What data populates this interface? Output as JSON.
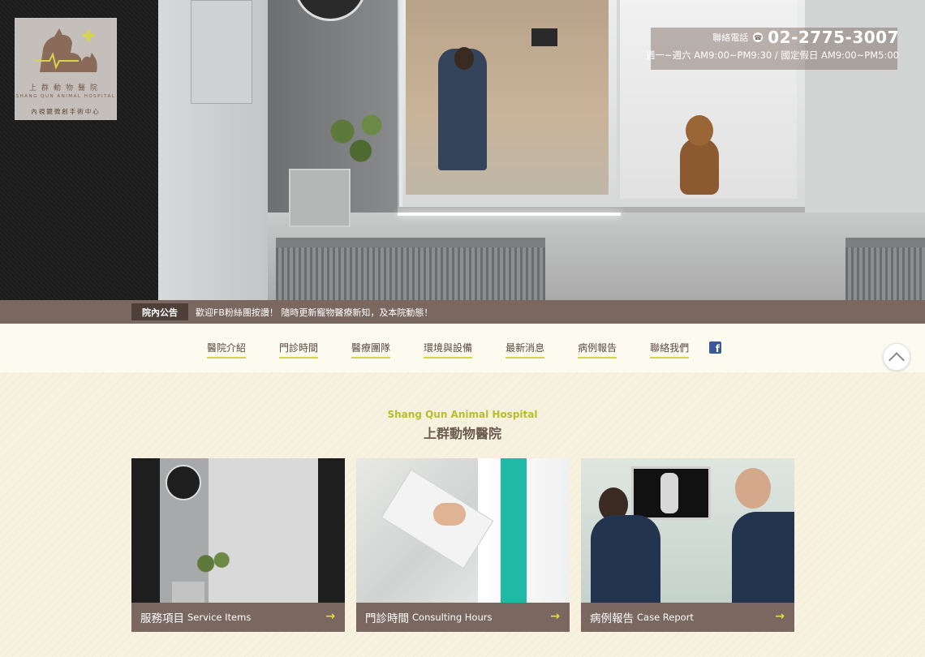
{
  "logo": {
    "name_zh": "上群動物醫院",
    "name_en": "SHANG QUN ANIMAL HOSPITAL",
    "tagline": "內視鏡微創手術中心"
  },
  "contact": {
    "phone_label": "聯絡電話",
    "phone_icon": "phone-icon",
    "phone": "02-2775-3007",
    "hours": "週一~週六 AM9:00~PM9:30 / 國定假日 AM9:00~PM5:00"
  },
  "notice": {
    "badge": "院內公告",
    "text": "歡迎FB粉絲團按讚！ 隨時更新寵物醫療新知，及本院動態！"
  },
  "nav": {
    "items": [
      {
        "label": "醫院介紹"
      },
      {
        "label": "門診時間"
      },
      {
        "label": "醫療團隊"
      },
      {
        "label": "環境與設備"
      },
      {
        "label": "最新消息"
      },
      {
        "label": "病例報告"
      },
      {
        "label": "聯絡我們"
      }
    ],
    "facebook_icon": "facebook-icon",
    "facebook_glyph": "f",
    "back_to_top_icon": "chevron-up-icon"
  },
  "section": {
    "subtitle_en": "Shang Qun Animal Hospital",
    "title_zh": "上群動物醫院"
  },
  "cards": [
    {
      "title_zh": "服務項目",
      "title_en": "Service Items",
      "arrow": "→"
    },
    {
      "title_zh": "門診時間",
      "title_en": "Consulting Hours",
      "arrow": "→"
    },
    {
      "title_zh": "病例報告",
      "title_en": "Case Report",
      "arrow": "→"
    }
  ],
  "colors": {
    "brown_bar": "#7a6760",
    "accent_lime": "#d4d34a",
    "background": "#f7f1df"
  }
}
